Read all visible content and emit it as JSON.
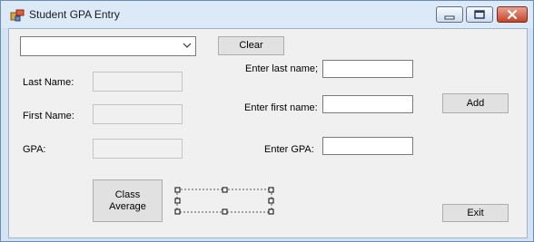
{
  "window": {
    "title": "Student GPA Entry"
  },
  "form": {
    "combo_value": "",
    "clear_label": "Clear",
    "last_name_label": "Last Name:",
    "first_name_label": "First Name:",
    "gpa_label": "GPA:",
    "last_name_value": "",
    "first_name_value": "",
    "gpa_value": "",
    "enter_last_label": "Enter last name;",
    "enter_first_label": "Enter first name:",
    "enter_gpa_label": "Enter GPA:",
    "enter_last_value": "",
    "enter_first_value": "",
    "enter_gpa_value": "",
    "add_label": "Add",
    "class_average_label": "Class Average",
    "average_value": "",
    "exit_label": "Exit"
  }
}
